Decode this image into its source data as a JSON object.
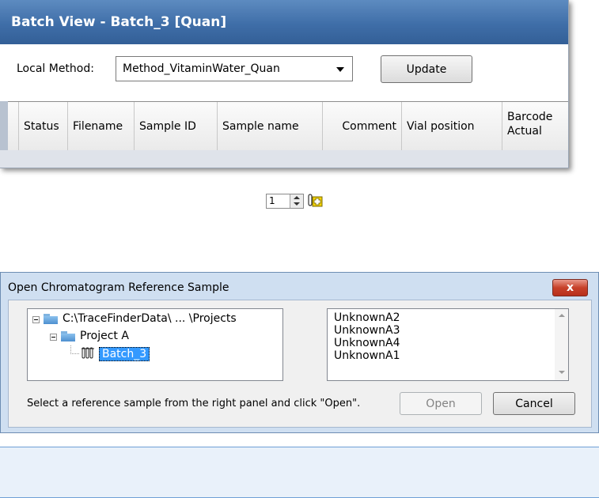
{
  "batch_view": {
    "title": "Batch View - Batch_3 [Quan]",
    "local_method_label": "Local Method:",
    "local_method_value": "Method_VitaminWater_Quan",
    "update_label": "Update",
    "columns": [
      "Status",
      "Filename",
      "Sample ID",
      "Sample name",
      "Comment",
      "Vial position"
    ],
    "barcode_col": {
      "line1": "Barcode",
      "line2": "Actual"
    },
    "accent_color": "#3f6ea8"
  },
  "stepper": {
    "value": "1"
  },
  "dialog": {
    "title": "Open Chromatogram Reference Sample",
    "close_label": "x",
    "tree": {
      "root": "C:\\TraceFinderData\\ ... \\Projects",
      "project": "Project A",
      "batch": "Batch_3"
    },
    "samples": [
      "UnknownA2",
      "UnknownA3",
      "UnknownA4",
      "UnknownA1"
    ],
    "hint": "Select a reference sample from the right panel and click \"Open\".",
    "open_label": "Open",
    "cancel_label": "Cancel"
  }
}
